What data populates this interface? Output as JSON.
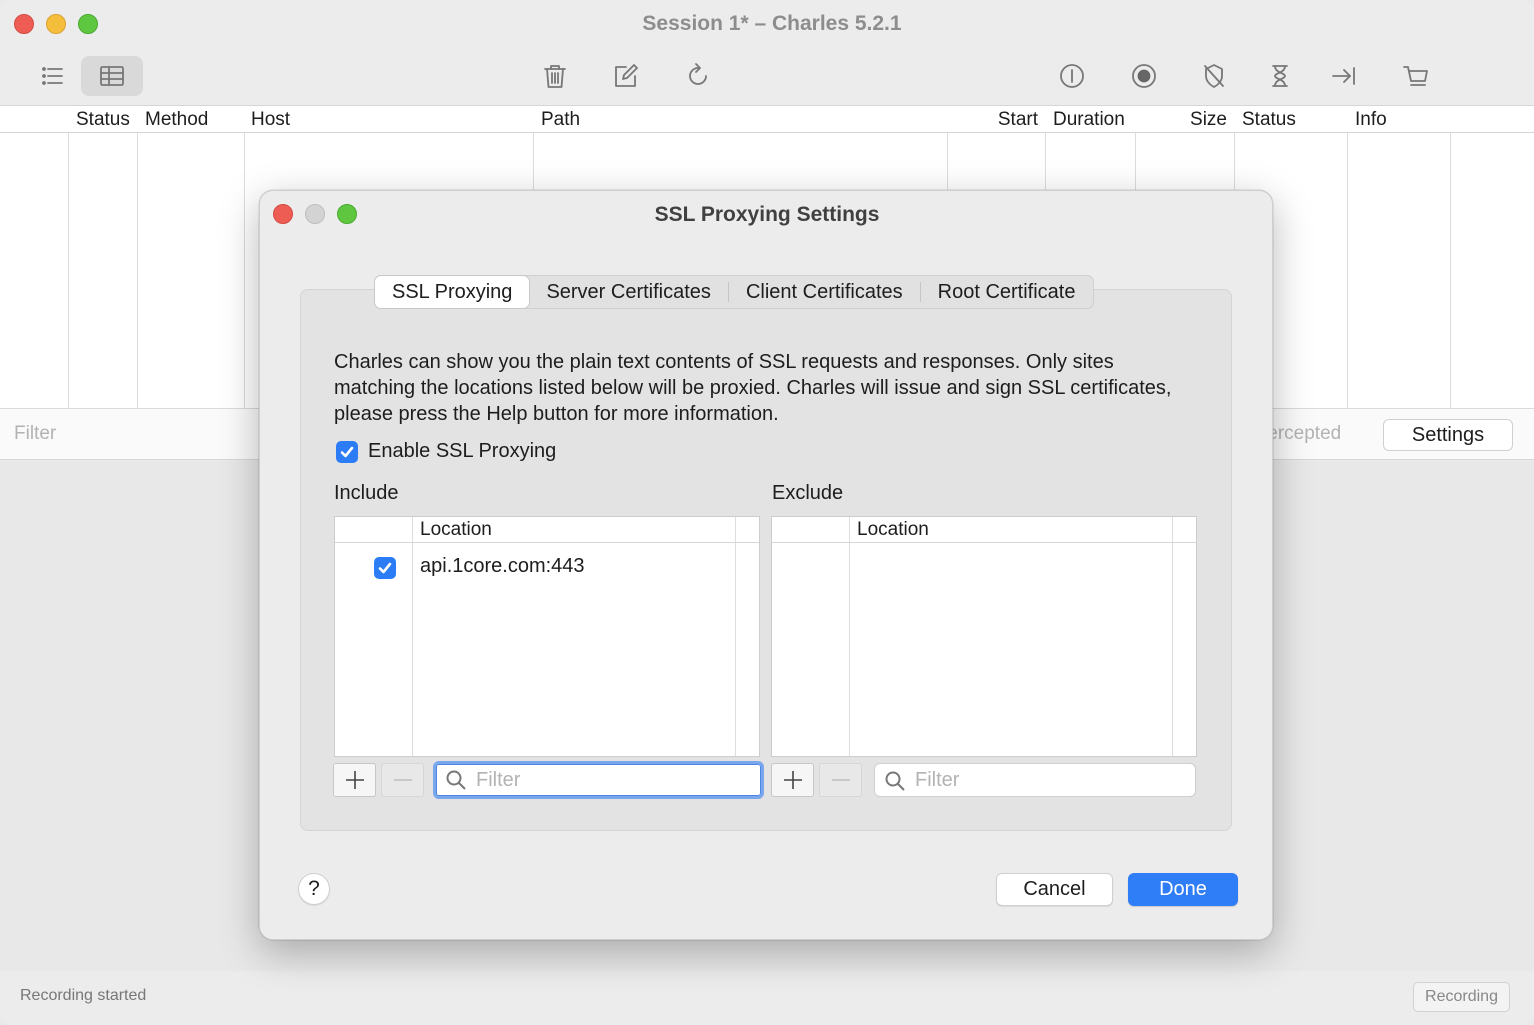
{
  "window": {
    "title": "Session 1* – Charles 5.2.1"
  },
  "toolbar": {
    "icons": [
      "list-view-icon",
      "table-view-icon",
      "trash-icon",
      "edit-icon",
      "refresh-icon",
      "throttle-icon",
      "record-icon",
      "breakpoint-icon",
      "hourglass-icon",
      "tab-arrow-icon",
      "cart-icon"
    ]
  },
  "table": {
    "columns": [
      "Status",
      "Method",
      "Host",
      "Path",
      "Start",
      "Duration",
      "Size",
      "Status",
      "Info"
    ]
  },
  "filterbar": {
    "placeholder": "Filter",
    "intercepted_label": "tercepted",
    "settings_label": "Settings"
  },
  "statusbar": {
    "text": "Recording started",
    "recording_label": "Recording"
  },
  "dialog": {
    "title": "SSL Proxying Settings",
    "tabs": [
      {
        "label": "SSL Proxying",
        "active": true
      },
      {
        "label": "Server Certificates",
        "active": false
      },
      {
        "label": "Client Certificates",
        "active": false
      },
      {
        "label": "Root Certificate",
        "active": false
      }
    ],
    "description": "Charles can show you the plain text contents of SSL requests and responses. Only sites matching the locations listed below will be proxied. Charles will issue and sign SSL certificates, please press the Help button for more information.",
    "enable_label": "Enable SSL Proxying",
    "enable_checked": true,
    "include": {
      "label": "Include",
      "column": "Location",
      "rows": [
        {
          "location": "api.1core.com:443",
          "enabled": true
        }
      ],
      "filter_placeholder": "Filter"
    },
    "exclude": {
      "label": "Exclude",
      "column": "Location",
      "rows": [],
      "filter_placeholder": "Filter"
    },
    "help_label": "?",
    "cancel_label": "Cancel",
    "done_label": "Done"
  },
  "colors": {
    "accent": "#2f7ef7",
    "close": "#ee5d54",
    "minimize": "#f4bd3c",
    "zoom": "#5fc63f"
  }
}
